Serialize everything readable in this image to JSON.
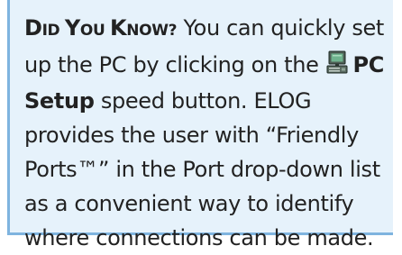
{
  "tip": {
    "lead": {
      "d1": "D",
      "d2": "ID ",
      "y1": "Y",
      "y2": "OU ",
      "k1": "K",
      "k2": "NOW?"
    },
    "text_1": "You can quickly set up the PC by clicking on the",
    "icon": "computer-icon",
    "pc_setup": "PC Setup",
    "text_2": "speed button. ELOG provides the user with “Friendly Ports™” in the Port drop-down list as a convenient way to identify where connections can be made."
  },
  "colors": {
    "box_background": "#e6f2fb",
    "box_border": "#7fb4df",
    "text": "#222222"
  }
}
